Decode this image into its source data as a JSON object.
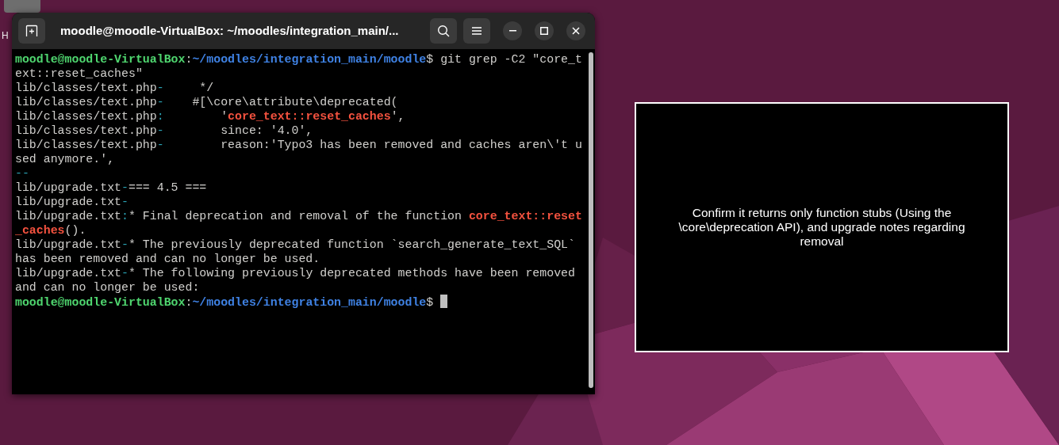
{
  "desktop": {
    "icon_label": "H"
  },
  "terminal": {
    "title": "moodle@moodle-VirtualBox: ~/moodles/integration_main/...",
    "lines": [
      [
        {
          "kind": "user",
          "text": "moodle@moodle-VirtualBox"
        },
        {
          "kind": "plain",
          "text": ":"
        },
        {
          "kind": "path",
          "text": "~/moodles/integration_main/moodle"
        },
        {
          "kind": "plain",
          "text": "$ git grep -C2 \"core_t"
        }
      ],
      [
        {
          "kind": "plain",
          "text": "ext::reset_caches\""
        }
      ],
      [
        {
          "kind": "plain",
          "text": "lib/classes/text.php"
        },
        {
          "kind": "sep",
          "text": "-"
        },
        {
          "kind": "plain",
          "text": "     */"
        }
      ],
      [
        {
          "kind": "plain",
          "text": "lib/classes/text.php"
        },
        {
          "kind": "sep",
          "text": "-"
        },
        {
          "kind": "plain",
          "text": "    #[\\core\\attribute\\deprecated("
        }
      ],
      [
        {
          "kind": "plain",
          "text": "lib/classes/text.php"
        },
        {
          "kind": "sep",
          "text": ":"
        },
        {
          "kind": "plain",
          "text": "        '"
        },
        {
          "kind": "match",
          "text": "core_text::reset_caches"
        },
        {
          "kind": "plain",
          "text": "',"
        }
      ],
      [
        {
          "kind": "plain",
          "text": "lib/classes/text.php"
        },
        {
          "kind": "sep",
          "text": "-"
        },
        {
          "kind": "plain",
          "text": "        since: '4.0',"
        }
      ],
      [
        {
          "kind": "plain",
          "text": "lib/classes/text.php"
        },
        {
          "kind": "sep",
          "text": "-"
        },
        {
          "kind": "plain",
          "text": "        reason:'Typo3 has been removed and caches aren\\'t u"
        }
      ],
      [
        {
          "kind": "plain",
          "text": "sed anymore.',"
        }
      ],
      [
        {
          "kind": "sep",
          "text": "--"
        }
      ],
      [
        {
          "kind": "plain",
          "text": "lib/upgrade.txt"
        },
        {
          "kind": "sep",
          "text": "-"
        },
        {
          "kind": "plain",
          "text": "=== 4.5 ==="
        }
      ],
      [
        {
          "kind": "plain",
          "text": "lib/upgrade.txt"
        },
        {
          "kind": "sep",
          "text": "-"
        }
      ],
      [
        {
          "kind": "plain",
          "text": "lib/upgrade.txt"
        },
        {
          "kind": "sep",
          "text": ":"
        },
        {
          "kind": "plain",
          "text": "* Final deprecation and removal of the function "
        },
        {
          "kind": "match",
          "text": "core_text::reset"
        }
      ],
      [
        {
          "kind": "match",
          "text": "_caches"
        },
        {
          "kind": "plain",
          "text": "()."
        }
      ],
      [
        {
          "kind": "plain",
          "text": "lib/upgrade.txt"
        },
        {
          "kind": "sep",
          "text": "-"
        },
        {
          "kind": "plain",
          "text": "* The previously deprecated function `search_generate_text_SQL`"
        }
      ],
      [
        {
          "kind": "plain",
          "text": "has been removed and can no longer be used."
        }
      ],
      [
        {
          "kind": "plain",
          "text": "lib/upgrade.txt"
        },
        {
          "kind": "sep",
          "text": "-"
        },
        {
          "kind": "plain",
          "text": "* The following previously deprecated methods have been removed"
        }
      ],
      [
        {
          "kind": "plain",
          "text": "and can no longer be used:"
        }
      ],
      [
        {
          "kind": "user",
          "text": "moodle@moodle-VirtualBox"
        },
        {
          "kind": "plain",
          "text": ":"
        },
        {
          "kind": "path",
          "text": "~/moodles/integration_main/moodle"
        },
        {
          "kind": "plain",
          "text": "$ "
        },
        {
          "kind": "cursor"
        }
      ]
    ]
  },
  "note": {
    "text": "Confirm it returns only function stubs (Using the \\core\\deprecation API), and upgrade notes regarding removal"
  }
}
